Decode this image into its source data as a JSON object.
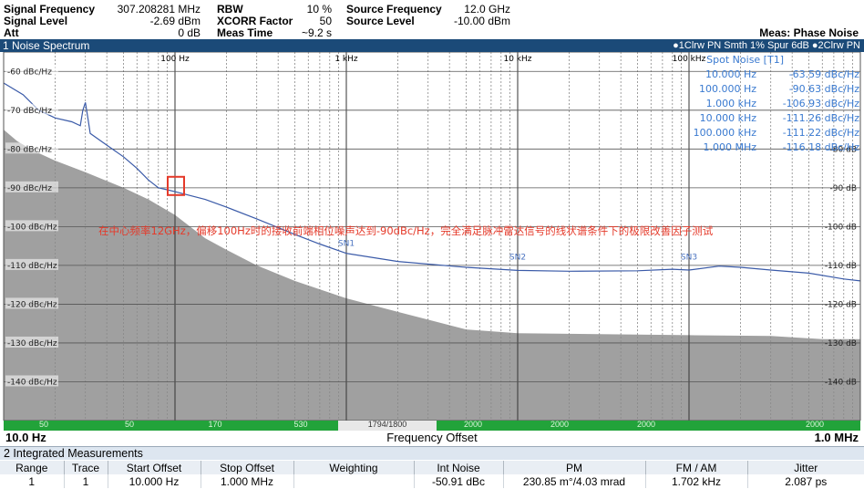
{
  "header": {
    "rows": [
      [
        {
          "label": "Signal Frequency",
          "value": "307.208281 MHz"
        },
        {
          "label": "RBW",
          "value": "10 %"
        },
        {
          "label": "Source Frequency",
          "value": "12.0 GHz"
        }
      ],
      [
        {
          "label": "Signal Level",
          "value": "-2.69 dBm"
        },
        {
          "label": "XCORR Factor",
          "value": "50"
        },
        {
          "label": "Source Level",
          "value": "-10.00 dBm"
        }
      ],
      [
        {
          "label": "Att",
          "value": "0 dB"
        },
        {
          "label": "Meas Time",
          "value": "~9.2 s"
        },
        {
          "label": "",
          "value": ""
        }
      ]
    ],
    "meas_mode": "Meas: Phase Noise"
  },
  "titlebar": {
    "title": "1 Noise Spectrum",
    "legend": "●1Clrw PN Smth 1% Spur 6dB ●2Clrw PN"
  },
  "chart_data": {
    "type": "line",
    "x_scale": "log",
    "xlim": [
      10,
      1000000
    ],
    "ylim": [
      -150,
      -55
    ],
    "x_ticks": [
      {
        "value": 100,
        "label": "100 Hz"
      },
      {
        "value": 1000,
        "label": "1 kHz"
      },
      {
        "value": 10000,
        "label": "10 kHz"
      },
      {
        "value": 100000,
        "label": "100 kHz"
      }
    ],
    "y_ticks": [
      {
        "value": -60,
        "label": "-60 dBc/Hz"
      },
      {
        "value": -70,
        "label": "-70 dBc/Hz"
      },
      {
        "value": -80,
        "label": "-80 dBc/Hz"
      },
      {
        "value": -90,
        "label": "-90 dBc/Hz"
      },
      {
        "value": -100,
        "label": "-100 dBc/Hz"
      },
      {
        "value": -110,
        "label": "-110 dBc/Hz"
      },
      {
        "value": -120,
        "label": "-120 dBc/Hz"
      },
      {
        "value": -130,
        "label": "-130 dBc/Hz"
      },
      {
        "value": -140,
        "label": "-140 dBc/Hz"
      }
    ],
    "right_ticks": [
      {
        "value": -80,
        "label": "-80 dB"
      },
      {
        "value": -90,
        "label": "-90 dB"
      },
      {
        "value": -100,
        "label": "-100 dB"
      },
      {
        "value": -110,
        "label": "-110 dB"
      },
      {
        "value": -120,
        "label": "-120 dB"
      },
      {
        "value": -130,
        "label": "-130 dB"
      },
      {
        "value": -140,
        "label": "-140 dB"
      }
    ],
    "grid": true,
    "series": [
      {
        "name": "1Clrw PN Smth 1% Spur 6dB",
        "color": "#3a5aa8",
        "points": [
          [
            10,
            -63
          ],
          [
            13,
            -66
          ],
          [
            16,
            -70
          ],
          [
            20,
            -72
          ],
          [
            25,
            -73
          ],
          [
            28,
            -74
          ],
          [
            29,
            -70
          ],
          [
            30,
            -68
          ],
          [
            31,
            -72
          ],
          [
            32,
            -76
          ],
          [
            40,
            -79
          ],
          [
            50,
            -82
          ],
          [
            60,
            -85
          ],
          [
            70,
            -88
          ],
          [
            80,
            -90
          ],
          [
            90,
            -90.5
          ],
          [
            100,
            -91
          ],
          [
            150,
            -93
          ],
          [
            200,
            -95
          ],
          [
            300,
            -98
          ],
          [
            500,
            -102
          ],
          [
            700,
            -104.5
          ],
          [
            1000,
            -106.9
          ],
          [
            2000,
            -109
          ],
          [
            5000,
            -110.5
          ],
          [
            10000,
            -111.3
          ],
          [
            20000,
            -111.5
          ],
          [
            50000,
            -111.4
          ],
          [
            80000,
            -111
          ],
          [
            100000,
            -111.2
          ],
          [
            150000,
            -110.2
          ],
          [
            200000,
            -110.5
          ],
          [
            300000,
            -111.2
          ],
          [
            500000,
            -112
          ],
          [
            800000,
            -113.5
          ],
          [
            1000000,
            -114
          ]
        ]
      },
      {
        "name": "2Clrw PN",
        "color": "#a0a0a0",
        "points": [
          [
            10,
            -75
          ],
          [
            12,
            -78
          ],
          [
            15,
            -80.5
          ],
          [
            20,
            -83
          ],
          [
            30,
            -86
          ],
          [
            50,
            -90
          ],
          [
            70,
            -93
          ],
          [
            100,
            -97
          ],
          [
            150,
            -103
          ],
          [
            200,
            -106
          ],
          [
            300,
            -110
          ],
          [
            500,
            -114
          ],
          [
            1000,
            -118.5
          ],
          [
            2000,
            -122
          ],
          [
            3000,
            -124
          ],
          [
            5000,
            -126.5
          ],
          [
            10000,
            -127.5
          ],
          [
            30000,
            -127.7
          ],
          [
            100000,
            -128
          ],
          [
            300000,
            -128.2
          ],
          [
            600000,
            -129
          ],
          [
            1000000,
            -129
          ]
        ]
      }
    ],
    "marker_labels": [
      {
        "text": "SN1",
        "x": 1000,
        "y": -105
      },
      {
        "text": "SN2",
        "x": 10000,
        "y": -108.5
      },
      {
        "text": "SN3",
        "x": 100000,
        "y": -108.5
      }
    ],
    "spot_noise": {
      "title": "Spot Noise [T1]",
      "rows": [
        {
          "freq": "10.000 Hz",
          "value": "-63.59 dBc/Hz"
        },
        {
          "freq": "100.000 Hz",
          "value": "-90.63 dBc/Hz"
        },
        {
          "freq": "1.000 kHz",
          "value": "-106.93 dBc/Hz"
        },
        {
          "freq": "10.000 kHz",
          "value": "-111.26 dBc/Hz"
        },
        {
          "freq": "100.000 kHz",
          "value": "-111.22 dBc/Hz"
        },
        {
          "freq": "1.000 MHz",
          "value": "-116.18 dBc/Hz"
        }
      ]
    },
    "annotation": {
      "text": "在中心频率12GHz，偏移100Hz时的接收前端相位噪声达到-90dBc/Hz，完全满足脉冲雷达信号的线状谱条件下的极限改善因子测试",
      "color": "#e53a2a",
      "box_x": 100,
      "box_y": -90
    }
  },
  "occupied_bar": {
    "labels": [
      "50",
      "50",
      "170",
      "530",
      "1794/1800",
      "2000",
      "2000",
      "2000",
      "2000"
    ]
  },
  "axis": {
    "start": "10.0 Hz",
    "center": "Frequency Offset",
    "stop": "1.0 MHz"
  },
  "integrated": {
    "title": "2 Integrated Measurements",
    "columns": [
      "Range",
      "Trace",
      "Start Offset",
      "Stop Offset",
      "Weighting",
      "Int Noise",
      "PM",
      "FM / AM",
      "Jitter"
    ],
    "rows": [
      [
        "1",
        "1",
        "10.000 Hz",
        "1.000 MHz",
        "",
        "-50.91 dBc",
        "230.85 m°/4.03 mrad",
        "1.702 kHz",
        "2.087 ps"
      ]
    ]
  }
}
